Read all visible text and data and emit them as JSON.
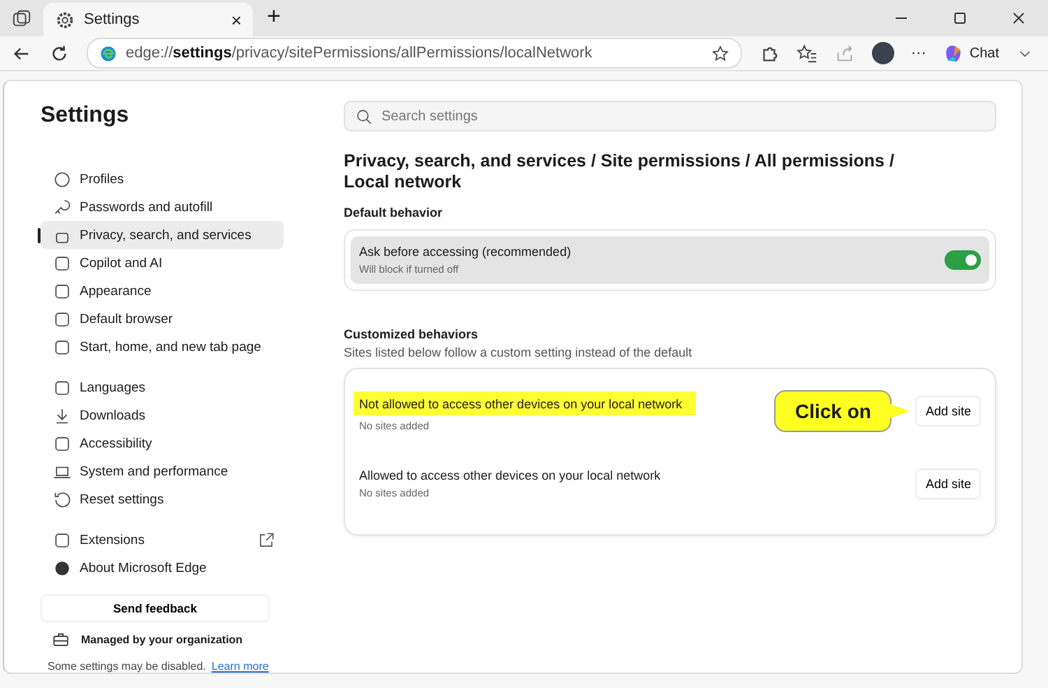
{
  "browser": {
    "tab_title": "Settings",
    "tab_close": "×",
    "new_tab": "+",
    "address": "edge://**settings**/privacy/sitePermissions/allPermissions/localNetwork",
    "more": "···",
    "chat": "Chat"
  },
  "sidebar": {
    "title": "Settings",
    "groups": [
      [
        {
          "label": "Profiles",
          "selected": false,
          "external": false
        },
        {
          "label": "Passwords and autofill",
          "selected": false,
          "external": false
        },
        {
          "label": "Privacy, search, and services",
          "selected": true,
          "external": false
        },
        {
          "label": "Copilot and AI",
          "selected": false,
          "external": false
        },
        {
          "label": "Appearance",
          "selected": false,
          "external": false
        },
        {
          "label": "Default browser",
          "selected": false,
          "external": false
        },
        {
          "label": "Start, home, and new tab page",
          "selected": false,
          "external": false
        }
      ],
      [
        {
          "label": "Languages",
          "selected": false,
          "external": false
        },
        {
          "label": "Downloads",
          "selected": false,
          "external": false
        },
        {
          "label": "Accessibility",
          "selected": false,
          "external": false
        },
        {
          "label": "System and performance",
          "selected": false,
          "external": false
        },
        {
          "label": "Reset settings",
          "selected": false,
          "external": false
        }
      ],
      [
        {
          "label": "Extensions",
          "selected": false,
          "external": true
        },
        {
          "label": "About Microsoft Edge",
          "selected": false,
          "external": false
        }
      ]
    ],
    "feedback": "Send feedback",
    "managed": "Managed by your organization",
    "managed_note": "Some settings may be disabled.",
    "learn_more": "Learn more"
  },
  "search": {
    "placeholder": "Search settings"
  },
  "breadcrumb": "Privacy, search, and services / Site permissions / All permissions / Local network",
  "default_behavior": {
    "heading": "Default behavior",
    "label": "Ask before accessing (recommended)",
    "note": "Will block if turned off",
    "on": true
  },
  "customized": {
    "heading": "Customized behaviors",
    "description": "Sites listed below follow a custom setting instead of the default",
    "rows": [
      {
        "label": "Not allowed to access other devices on your local network",
        "note": "No sites added",
        "button": "Add site",
        "highlighted": true,
        "callout": "Click on"
      },
      {
        "label": "Allowed to access other devices on your local network",
        "note": "No sites added",
        "button": "Add site",
        "highlighted": false
      }
    ]
  }
}
